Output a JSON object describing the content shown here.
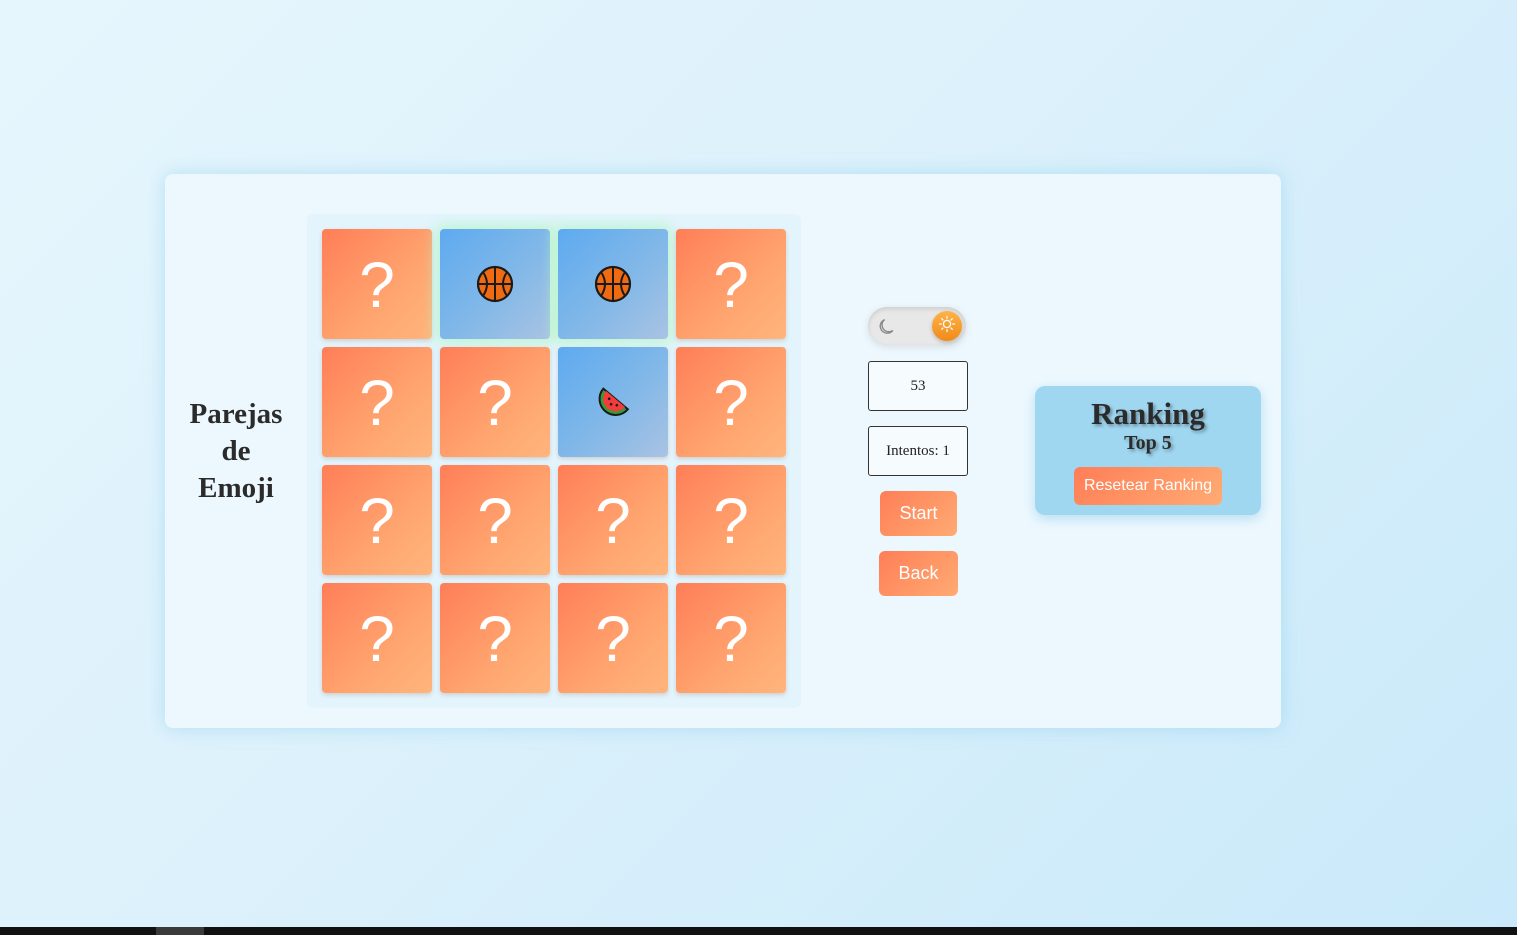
{
  "game": {
    "title_lines": [
      "Parejas",
      "de",
      "Emoji"
    ],
    "hidden_symbol": "?",
    "cards": [
      {
        "state": "hidden",
        "emoji": ""
      },
      {
        "state": "matched",
        "emoji": "basketball"
      },
      {
        "state": "matched",
        "emoji": "basketball"
      },
      {
        "state": "hidden",
        "emoji": ""
      },
      {
        "state": "hidden",
        "emoji": ""
      },
      {
        "state": "hidden",
        "emoji": ""
      },
      {
        "state": "revealed",
        "emoji": "watermelon"
      },
      {
        "state": "hidden",
        "emoji": ""
      },
      {
        "state": "hidden",
        "emoji": ""
      },
      {
        "state": "hidden",
        "emoji": ""
      },
      {
        "state": "hidden",
        "emoji": ""
      },
      {
        "state": "hidden",
        "emoji": ""
      },
      {
        "state": "hidden",
        "emoji": ""
      },
      {
        "state": "hidden",
        "emoji": ""
      },
      {
        "state": "hidden",
        "emoji": ""
      },
      {
        "state": "hidden",
        "emoji": ""
      }
    ]
  },
  "controls": {
    "theme_toggle": {
      "left_icon": "moon-icon",
      "active_icon": "sun-icon",
      "mode": "light"
    },
    "timer_value": "53",
    "attempts_label": "Intentos: 1",
    "start_label": "Start",
    "back_label": "Back"
  },
  "ranking": {
    "title": "Ranking",
    "subtitle": "Top 5",
    "reset_label": "Resetear Ranking"
  },
  "colors": {
    "card_back": "#ff8e63",
    "card_face": "#7fb5ea",
    "ranking_bg": "#9fd6f0",
    "toggle_knob": "#f59a2a"
  }
}
